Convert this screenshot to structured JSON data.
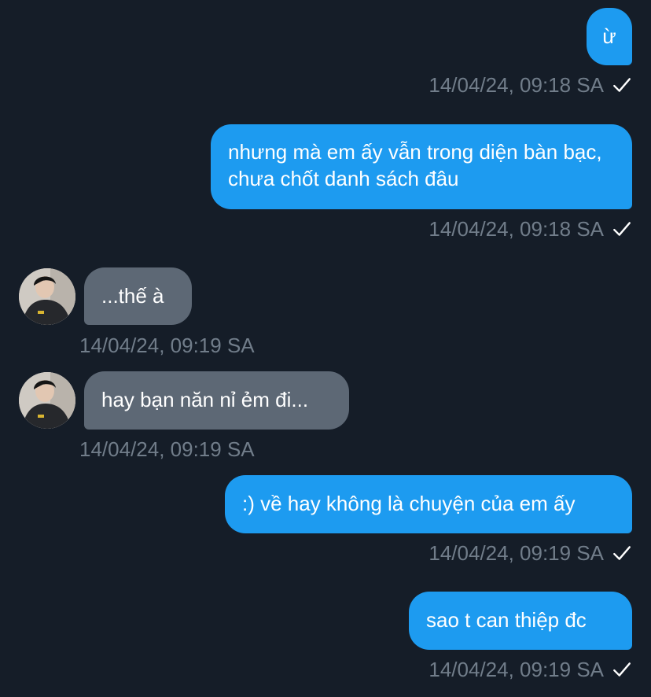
{
  "conversation": {
    "messages": [
      {
        "direction": "out",
        "text": "ừ",
        "timestamp": "14/04/24, 09:18 SA",
        "status": "check-icon"
      },
      {
        "direction": "out",
        "text": "nhưng mà em ấy vẫn trong diện bàn bạc, chưa chốt danh sách đâu",
        "timestamp": "14/04/24, 09:18 SA",
        "status": "check-icon"
      },
      {
        "direction": "in",
        "text": "...thế à",
        "timestamp": "14/04/24, 09:19 SA"
      },
      {
        "direction": "in",
        "text": "hay bạn năn nỉ ẻm đi...",
        "timestamp": "14/04/24, 09:19 SA"
      },
      {
        "direction": "out",
        "text": ":) về hay không là chuyện của em ấy",
        "timestamp": "14/04/24, 09:19 SA",
        "status": "check-icon"
      },
      {
        "direction": "out",
        "text": "sao t can thiệp đc",
        "timestamp": "14/04/24, 09:19 SA",
        "status": "check-icon"
      }
    ]
  },
  "colors": {
    "background": "#151d28",
    "outgoing_bubble": "#1d9bf0",
    "incoming_bubble": "#5d6875",
    "timestamp": "#717d8a"
  }
}
